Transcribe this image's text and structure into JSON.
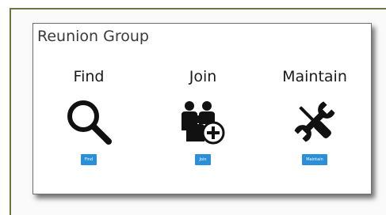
{
  "card": {
    "title": "Reunion Group"
  },
  "columns": [
    {
      "title": "Find",
      "icon": "magnifier-icon",
      "button_label": "Find"
    },
    {
      "title": "Join",
      "icon": "join-group-icon",
      "button_label": "Join"
    },
    {
      "title": "Maintain",
      "icon": "wrench-screwdriver-icon",
      "button_label": "Maintain"
    }
  ],
  "colors": {
    "button": "#2a8fd8",
    "frame_border": "#6e7640",
    "icon": "#111111"
  }
}
